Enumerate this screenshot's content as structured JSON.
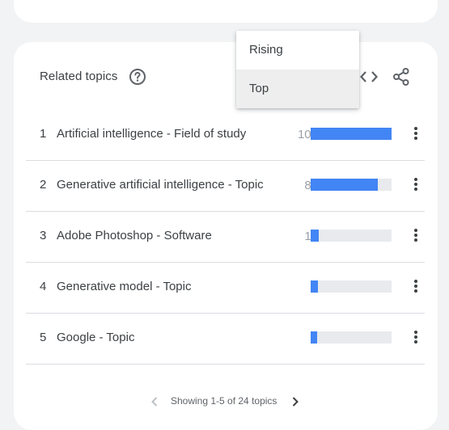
{
  "related_topics": {
    "title": "Related topics",
    "rows": [
      {
        "rank": "1",
        "topic": "Artificial intelligence - Field of study",
        "value": "100",
        "fill_percent": 100
      },
      {
        "rank": "2",
        "topic": "Generative artificial intelligence - Topic",
        "value": "83",
        "fill_percent": 83
      },
      {
        "rank": "3",
        "topic": "Adobe Photoshop - Software",
        "value": "10",
        "fill_percent": 10
      },
      {
        "rank": "4",
        "topic": "Generative model - Topic",
        "value": "9",
        "fill_percent": 9
      },
      {
        "rank": "5",
        "topic": "Google - Topic",
        "value": "8",
        "fill_percent": 8
      }
    ],
    "pager_text": "Showing 1-5 of 24 topics"
  },
  "dropdown": {
    "options": [
      "Rising",
      "Top"
    ],
    "selected": "Top"
  },
  "colors": {
    "bar_fill": "#4285f4",
    "bar_track": "#e8eaed",
    "value_text": "#9aa0a6"
  },
  "icons": {
    "help": "help-circle-icon",
    "embed": "code-embed-icon",
    "share": "share-icon",
    "row_menu": "more-vertical-icon",
    "prev": "chevron-left-icon",
    "next": "chevron-right-icon"
  }
}
